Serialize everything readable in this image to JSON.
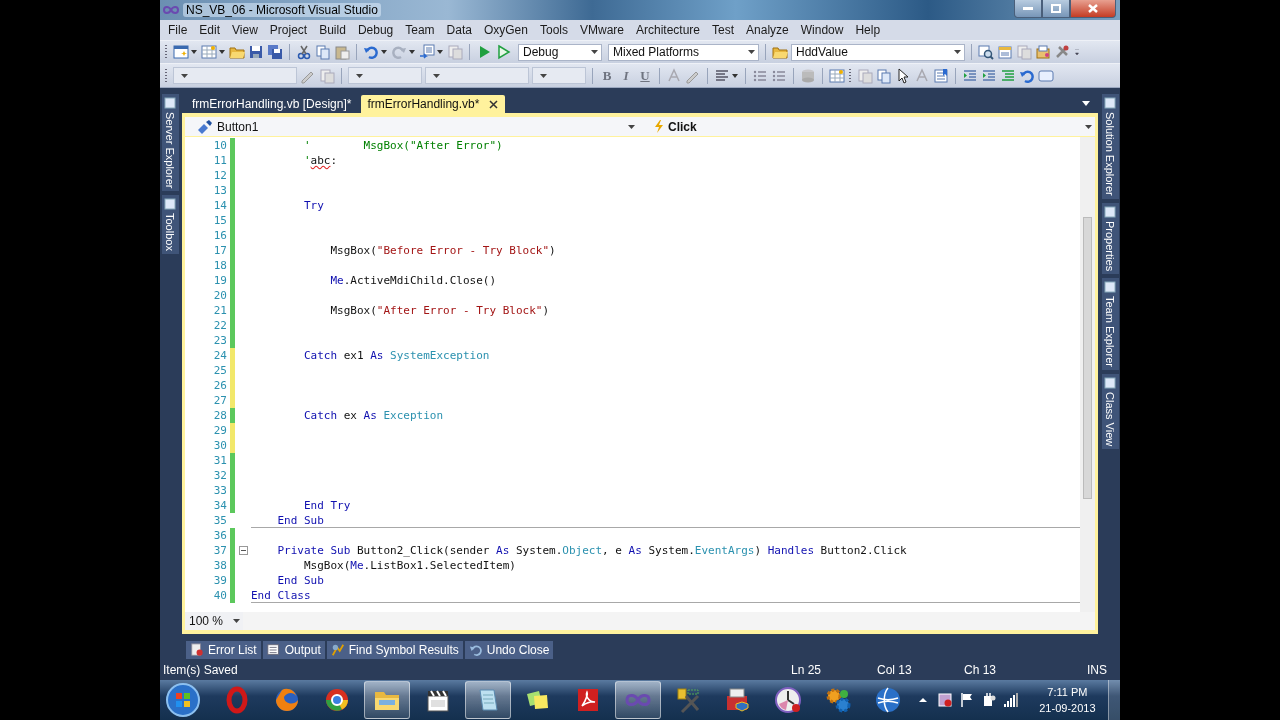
{
  "window": {
    "title": "NS_VB_06 - Microsoft Visual Studio"
  },
  "menu": [
    "File",
    "Edit",
    "View",
    "Project",
    "Build",
    "Debug",
    "Team",
    "Data",
    "OxyGen",
    "Tools",
    "VMware",
    "Architecture",
    "Test",
    "Analyze",
    "Window",
    "Help"
  ],
  "toolbar": {
    "configuration": "Debug",
    "platform": "Mixed Platforms",
    "find": "HddValue",
    "format_buttons": [
      "B",
      "I",
      "U"
    ]
  },
  "left_dock": [
    {
      "label": "Server Explorer"
    },
    {
      "label": "Toolbox"
    }
  ],
  "right_dock": [
    {
      "label": "Solution Explorer"
    },
    {
      "label": "Properties"
    },
    {
      "label": "Team Explorer"
    },
    {
      "label": "Class View"
    }
  ],
  "document_tabs": [
    {
      "label": "frmErrorHandling.vb [Design]*",
      "selected": false
    },
    {
      "label": "frmErrorHandling.vb*",
      "selected": true
    }
  ],
  "editor": {
    "object": "Button1",
    "event": "Click",
    "zoom": "100 %",
    "lines": [
      {
        "number": "10",
        "color": "#5cc85c",
        "tokens": [
          {
            "t": "        '        MsgBox(\"After Error\")",
            "kind": "comment"
          }
        ]
      },
      {
        "number": "11",
        "color": "#5cc85c",
        "tokens": [
          {
            "t": "        '",
            "kind": "comment"
          },
          {
            "t": "abc",
            "kind": "error"
          },
          {
            "t": ":",
            "kind": "plain"
          }
        ]
      },
      {
        "number": "12",
        "color": "#5cc85c"
      },
      {
        "number": "13",
        "color": "#5cc85c"
      },
      {
        "number": "14",
        "color": "#5cc85c",
        "tokens": [
          {
            "t": "        Try",
            "kind": "keyword"
          }
        ]
      },
      {
        "number": "15",
        "color": "#5cc85c"
      },
      {
        "number": "16",
        "color": "#5cc85c"
      },
      {
        "number": "17",
        "color": "#5cc85c",
        "tokens": [
          {
            "t": "            MsgBox(",
            "kind": "plain"
          },
          {
            "t": "\"Before Error - Try Block\"",
            "kind": "string"
          },
          {
            "t": ")",
            "kind": "plain"
          }
        ]
      },
      {
        "number": "18",
        "color": "#5cc85c"
      },
      {
        "number": "19",
        "color": "#5cc85c",
        "tokens": [
          {
            "t": "            Me",
            "kind": "keyword"
          },
          {
            "t": ".ActiveMdiChild.Close()",
            "kind": "plain"
          }
        ]
      },
      {
        "number": "20",
        "color": "#5cc85c"
      },
      {
        "number": "21",
        "color": "#5cc85c",
        "tokens": [
          {
            "t": "            MsgBox(",
            "kind": "plain"
          },
          {
            "t": "\"After Error - Try Block\"",
            "kind": "string"
          },
          {
            "t": ")",
            "kind": "plain"
          }
        ]
      },
      {
        "number": "22",
        "color": "#5cc85c"
      },
      {
        "number": "23",
        "color": "#5cc85c"
      },
      {
        "number": "24",
        "color": "#f2e86a",
        "tokens": [
          {
            "t": "        Catch",
            "kind": "keyword"
          },
          {
            "t": " ex1 ",
            "kind": "plain"
          },
          {
            "t": "As",
            "kind": "keyword"
          },
          {
            "t": " SystemException",
            "kind": "type"
          }
        ]
      },
      {
        "number": "25",
        "color": "#f2e86a"
      },
      {
        "number": "26",
        "color": "#f2e86a"
      },
      {
        "number": "27",
        "color": "#f2e86a"
      },
      {
        "number": "28",
        "color": "#5cc85c",
        "tokens": [
          {
            "t": "        Catch",
            "kind": "keyword"
          },
          {
            "t": " ex ",
            "kind": "plain"
          },
          {
            "t": "As",
            "kind": "keyword"
          },
          {
            "t": " Exception",
            "kind": "type"
          }
        ]
      },
      {
        "number": "29",
        "color": "#f2e86a"
      },
      {
        "number": "30",
        "color": "#f2e86a"
      },
      {
        "number": "31",
        "color": "#5cc85c"
      },
      {
        "number": "32",
        "color": "#5cc85c"
      },
      {
        "number": "33",
        "color": "#5cc85c"
      },
      {
        "number": "34",
        "color": "#5cc85c",
        "tokens": [
          {
            "t": "        End Try",
            "kind": "keyword"
          }
        ]
      },
      {
        "number": "35",
        "separator": true,
        "tokens": [
          {
            "t": "    End Sub",
            "kind": "keyword"
          }
        ]
      },
      {
        "number": "36",
        "color": "#5cc85c"
      },
      {
        "number": "37",
        "color": "#5cc85c",
        "fold": true,
        "tokens": [
          {
            "t": "    Private Sub",
            "kind": "keyword"
          },
          {
            "t": " Button2_Click(sender ",
            "kind": "plain"
          },
          {
            "t": "As",
            "kind": "keyword"
          },
          {
            "t": " System.",
            "kind": "plain"
          },
          {
            "t": "Object",
            "kind": "type"
          },
          {
            "t": ", e ",
            "kind": "plain"
          },
          {
            "t": "As",
            "kind": "keyword"
          },
          {
            "t": " System.",
            "kind": "plain"
          },
          {
            "t": "EventArgs",
            "kind": "type"
          },
          {
            "t": ") ",
            "kind": "plain"
          },
          {
            "t": "Handles",
            "kind": "keyword"
          },
          {
            "t": " Button2.Click",
            "kind": "plain"
          }
        ]
      },
      {
        "number": "38",
        "color": "#5cc85c",
        "tokens": [
          {
            "t": "        MsgBox(",
            "kind": "plain"
          },
          {
            "t": "Me",
            "kind": "keyword"
          },
          {
            "t": ".ListBox1.SelectedItem)",
            "kind": "plain"
          }
        ]
      },
      {
        "number": "39",
        "color": "#5cc85c",
        "tokens": [
          {
            "t": "    End Sub",
            "kind": "keyword"
          }
        ]
      },
      {
        "number": "40",
        "color": "#5cc85c",
        "separator": true,
        "tokens": [
          {
            "t": "End Class",
            "kind": "keyword"
          }
        ]
      }
    ]
  },
  "tool_tabs": [
    {
      "label": "Error List",
      "kind": "errors"
    },
    {
      "label": "Output",
      "kind": "output"
    },
    {
      "label": "Find Symbol Results",
      "kind": "symbols"
    },
    {
      "label": "Undo Close",
      "kind": "undo"
    }
  ],
  "status_bar": {
    "message": "Item(s) Saved",
    "line": "Ln 25",
    "column": "Col 13",
    "char": "Ch 13",
    "mode": "INS"
  },
  "taskbar": {
    "apps": [
      {
        "kind": "ring",
        "running": false
      },
      {
        "kind": "fox",
        "running": false
      },
      {
        "kind": "wheel",
        "running": false
      },
      {
        "kind": "folder",
        "running": true
      },
      {
        "kind": "clapper",
        "running": false
      },
      {
        "kind": "notepad",
        "running": true
      },
      {
        "kind": "notes",
        "running": false
      },
      {
        "kind": "pdf",
        "running": false
      },
      {
        "kind": "infinity",
        "running": true
      },
      {
        "kind": "tools",
        "running": false
      },
      {
        "kind": "toolbox",
        "running": false
      },
      {
        "kind": "clock",
        "running": false
      },
      {
        "kind": "gears",
        "running": false
      },
      {
        "kind": "globe",
        "running": false
      }
    ],
    "time": "7:11 PM",
    "date": "21-09-2013"
  }
}
